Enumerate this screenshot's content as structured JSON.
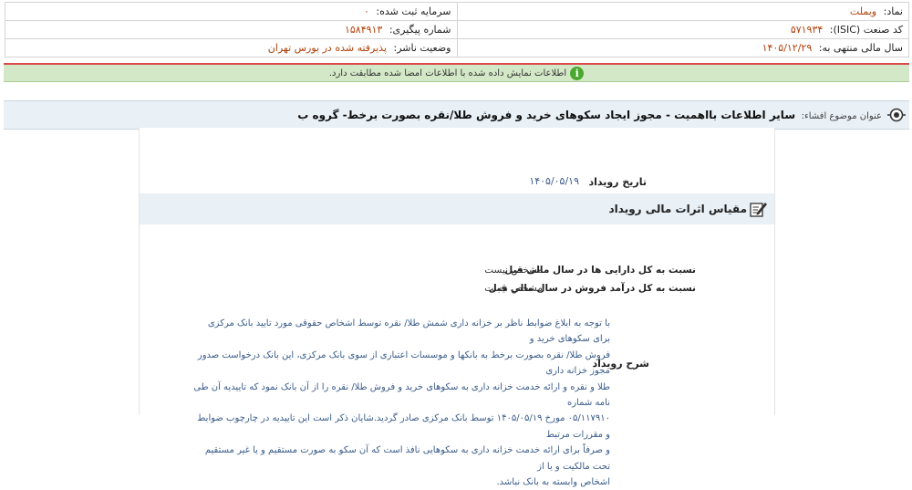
{
  "header": {
    "symbol_label": "نماد:",
    "symbol_value": "وبملت",
    "registered_capital_label": "سرمایه ثبت شده:",
    "registered_capital_value": "۰",
    "isic_label": "کد صنعت (ISIC):",
    "isic_value": "۵۷۱۹۳۴",
    "tracking_label": "شماره پیگیری:",
    "tracking_value": "۱۵۸۴۹۱۳",
    "fiscal_year_label": "سال مالی منتهی به:",
    "fiscal_year_value": "۱۴۰۵/۱۲/۲۹",
    "publisher_status_label": "وضعیت ناشر:",
    "publisher_status_value": "پذیرفته شده در بورس تهران"
  },
  "notice": {
    "text": "اطلاعات نمایش داده شده با اطلاعات امضا شده مطابقت دارد."
  },
  "topic": {
    "label": "عنوان موضوع افشاء:",
    "title": "سایر اطلاعات بااهمیت - مجوز ایجاد سکوهای خرید و فروش طلا/نقره بصورت برخط- گروه ب"
  },
  "event": {
    "date_label": "تاریخ رویداد",
    "date_value": "۱۴۰۵/۰۵/۱۹",
    "section_title": "مقیاس اثرات مالی رویداد",
    "rows": [
      {
        "label": "نسبت به کل دارایی ها در سال مالی قبل",
        "value": "مشخص نیست"
      },
      {
        "label": "نسبت به کل درآمد فروش در سال مالی قبل",
        "value": "مشخص نیست"
      }
    ],
    "description_label": "شرح رویداد",
    "description_lines": [
      "با توجه به ابلاغ ضوابط ناظر بر خزانه داری شمش طلا/ نقره توسط اشخاص حقوقی مورد تایید بانک مرکزی برای سکوهای خرید و",
      "فروش طلا/ نقره بصورت برخط به بانکها و موسسات اعتباری از سوی بانک مرکزی، این بانک درخواست صدور مجوز خزانه داری",
      "طلا و نقره و ارائه خدمت خزانه داری به سکوهای خرید و فروش طلا/ نقره را از آن بانک نمود که تاییدیه آن طی نامه شماره",
      "۰۵/۱۱۷۹۱۰ مورخ ۱۴۰۵/۰۵/۱۹ توسط بانک مرکزی صادر گردید.شایان ذکر است این تاییدیه در چارچوب ضوابط و مقررات مرتبط",
      "و صرفاً برای ارائه خدمت خزانه داری به سکوهایی نافذ است که آن سکو به صورت مستقیم و یا غیر مستقیم تحت مالکیت و یا از",
      "اشخاص وابسته به بانک نباشد."
    ]
  }
}
